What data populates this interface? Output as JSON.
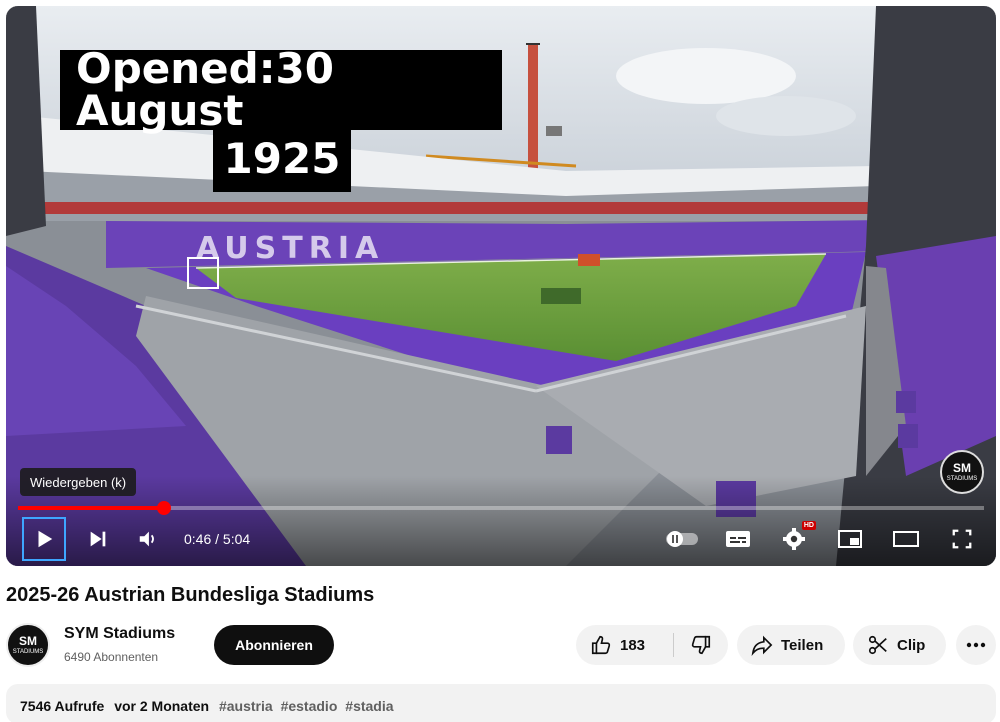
{
  "player": {
    "overlay_line1": "Opened:30 August",
    "overlay_line2": "1925",
    "tooltip": "Wiedergeben (k)",
    "current_time": "0:46",
    "duration": "5:04",
    "time_display": "0:46 / 5:04",
    "progress_fraction": 0.1513,
    "hd_badge": "HD",
    "watermark_mono": "SM",
    "watermark_text": "STADIUMS",
    "icons": [
      "play-icon",
      "next-icon",
      "volume-icon",
      "autoplay-toggle-icon",
      "subtitles-icon",
      "settings-icon",
      "miniplayer-icon",
      "theater-icon",
      "fullscreen-icon"
    ]
  },
  "video": {
    "title": "2025-26 Austrian Bundesliga Stadiums"
  },
  "channel": {
    "name": "SYM Stadiums",
    "subscribers": "6490 Abonnenten",
    "avatar_mono": "SM",
    "avatar_text": "STADIUMS",
    "subscribe_label": "Abonnieren"
  },
  "actions": {
    "likes": "183",
    "share_label": "Teilen",
    "clip_label": "Clip"
  },
  "description": {
    "views": "7546 Aufrufe",
    "age": "vor 2 Monaten",
    "tags": [
      "#austria",
      "#estadio",
      "#stadia"
    ]
  },
  "colors": {
    "accent": "#ff0000",
    "pitch": "#5f9a3a",
    "seats": "#6a3fb5",
    "subscribe_bg": "#0f0f0f",
    "pill_bg": "#f2f2f2"
  }
}
